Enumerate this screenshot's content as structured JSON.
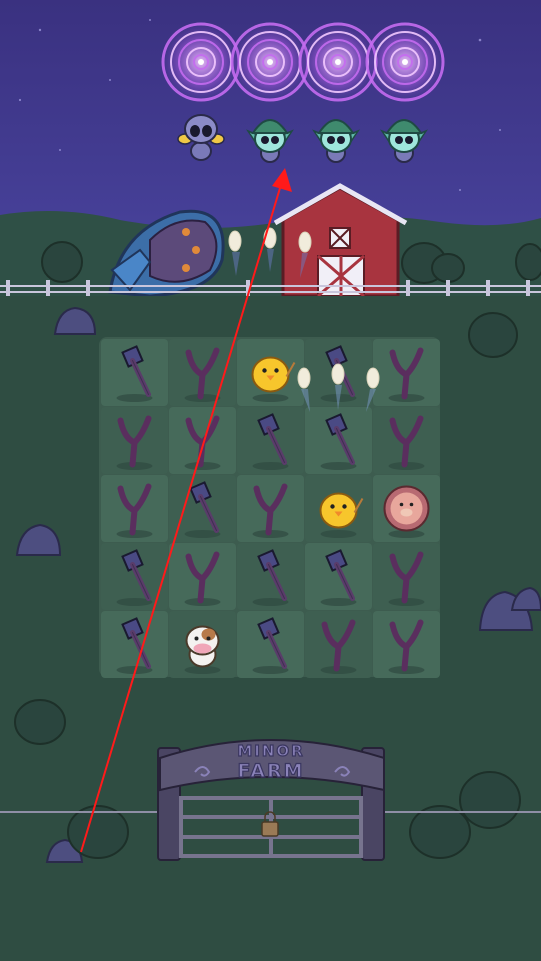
{
  "game": {
    "gate_sign": {
      "line1": "MINOR",
      "line2": "FARM"
    },
    "board": {
      "rows": 5,
      "cols": 5,
      "cells": [
        [
          "hammer",
          "slingshot",
          "chick",
          "hammer",
          "slingshot"
        ],
        [
          "slingshot",
          "slingshot",
          "hammer",
          "hammer",
          "slingshot"
        ],
        [
          "slingshot",
          "hammer",
          "slingshot",
          "chick",
          "pig-badge"
        ],
        [
          "hammer",
          "slingshot",
          "hammer",
          "hammer",
          "slingshot"
        ],
        [
          "hammer",
          "cow",
          "hammer",
          "slingshot",
          "slingshot"
        ]
      ]
    },
    "enemies": [
      {
        "type": "alien-gray-antenna"
      },
      {
        "type": "alien-green-helmet"
      },
      {
        "type": "alien-green-helmet"
      },
      {
        "type": "alien-green-helmet"
      }
    ],
    "portals": 4,
    "colors": {
      "night_sky": "#3d3581",
      "ground": "#2f4d42",
      "portal": "#c879f2",
      "barn": "#a8343f",
      "arrow": "#ff1a1a"
    }
  }
}
